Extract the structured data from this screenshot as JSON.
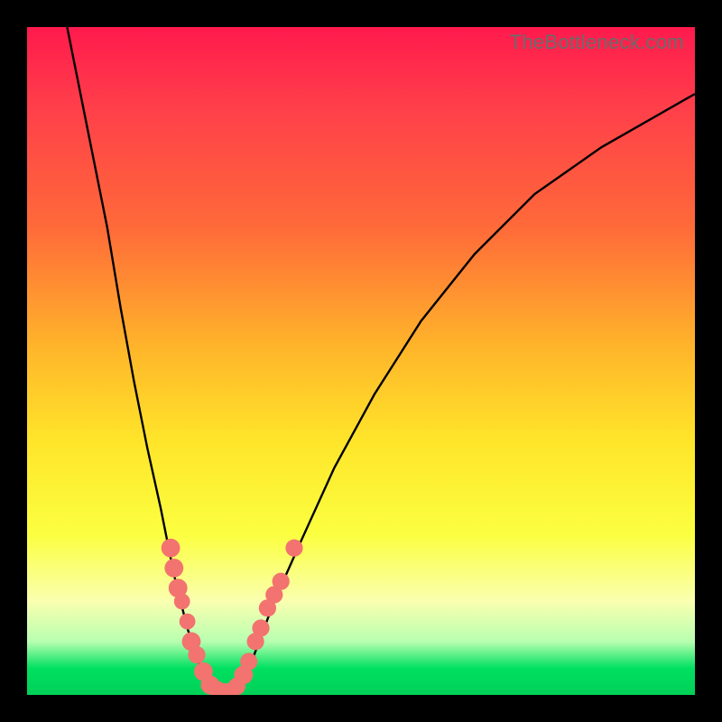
{
  "watermark": "TheBottleneck.com",
  "colors": {
    "curve": "#000000",
    "marker": "#f2736f",
    "background_frame": "#000000"
  },
  "chart_data": {
    "type": "line",
    "title": "",
    "xlabel": "",
    "ylabel": "",
    "xlim": [
      0,
      100
    ],
    "ylim": [
      0,
      100
    ],
    "curve": [
      {
        "x": 6,
        "y": 100
      },
      {
        "x": 8,
        "y": 90
      },
      {
        "x": 10,
        "y": 80
      },
      {
        "x": 12,
        "y": 70
      },
      {
        "x": 14,
        "y": 58
      },
      {
        "x": 16,
        "y": 47
      },
      {
        "x": 18,
        "y": 37
      },
      {
        "x": 20,
        "y": 28
      },
      {
        "x": 22,
        "y": 18
      },
      {
        "x": 24,
        "y": 10
      },
      {
        "x": 26,
        "y": 4
      },
      {
        "x": 28,
        "y": 1
      },
      {
        "x": 30,
        "y": 0
      },
      {
        "x": 32,
        "y": 2
      },
      {
        "x": 34,
        "y": 6
      },
      {
        "x": 37,
        "y": 14
      },
      {
        "x": 41,
        "y": 23
      },
      {
        "x": 46,
        "y": 34
      },
      {
        "x": 52,
        "y": 45
      },
      {
        "x": 59,
        "y": 56
      },
      {
        "x": 67,
        "y": 66
      },
      {
        "x": 76,
        "y": 75
      },
      {
        "x": 86,
        "y": 82
      },
      {
        "x": 100,
        "y": 90
      }
    ],
    "markers": [
      {
        "x": 21.5,
        "y": 22,
        "r": 1.4
      },
      {
        "x": 22.0,
        "y": 19,
        "r": 1.4
      },
      {
        "x": 22.6,
        "y": 16,
        "r": 1.4
      },
      {
        "x": 23.2,
        "y": 14,
        "r": 1.2
      },
      {
        "x": 24.0,
        "y": 11,
        "r": 1.2
      },
      {
        "x": 24.6,
        "y": 8,
        "r": 1.4
      },
      {
        "x": 25.4,
        "y": 6,
        "r": 1.3
      },
      {
        "x": 26.4,
        "y": 3.5,
        "r": 1.4
      },
      {
        "x": 27.4,
        "y": 1.5,
        "r": 1.4
      },
      {
        "x": 28.4,
        "y": 0.8,
        "r": 1.3
      },
      {
        "x": 29.4,
        "y": 0.5,
        "r": 1.3
      },
      {
        "x": 30.4,
        "y": 0.5,
        "r": 1.3
      },
      {
        "x": 31.4,
        "y": 1.3,
        "r": 1.3
      },
      {
        "x": 32.4,
        "y": 3,
        "r": 1.4
      },
      {
        "x": 33.2,
        "y": 5,
        "r": 1.3
      },
      {
        "x": 34.2,
        "y": 8,
        "r": 1.3
      },
      {
        "x": 35.0,
        "y": 10,
        "r": 1.3
      },
      {
        "x": 36.0,
        "y": 13,
        "r": 1.3
      },
      {
        "x": 37.0,
        "y": 15,
        "r": 1.3
      },
      {
        "x": 38.0,
        "y": 17,
        "r": 1.3
      },
      {
        "x": 40.0,
        "y": 22,
        "r": 1.3
      }
    ]
  }
}
